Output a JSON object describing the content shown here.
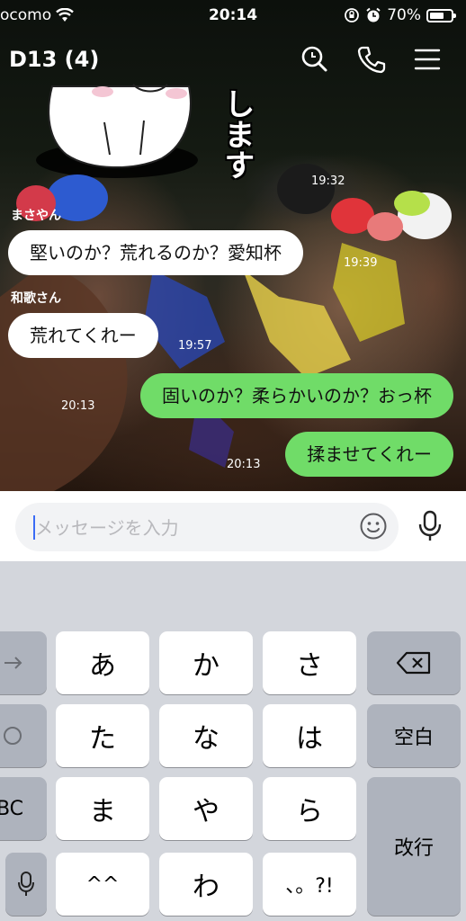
{
  "status_bar": {
    "carrier": "ocomo",
    "time": "20:14",
    "battery_percent": "70%",
    "battery_level": 0.7,
    "icons": [
      "wifi-icon",
      "orientation-lock-icon",
      "alarm-icon"
    ]
  },
  "header": {
    "title": "D13 (4)",
    "icons": [
      "search-icon",
      "phone-icon",
      "menu-icon"
    ]
  },
  "background": {
    "sticker_text": "します",
    "sticker_timestamp": "19:32"
  },
  "messages": [
    {
      "sender": "まさやん",
      "text": "堅いのか？荒れるのか？愛知杯",
      "time": "19:39",
      "direction": "incoming"
    },
    {
      "sender": "和歌さん",
      "text": "荒れてくれー",
      "time": "19:57",
      "direction": "incoming"
    },
    {
      "sender": "",
      "text": "固いのか？柔らかいのか？おっ杯",
      "time": "20:13",
      "direction": "outgoing"
    },
    {
      "sender": "",
      "text": "揉ませてくれー",
      "time": "20:13",
      "direction": "outgoing"
    }
  ],
  "input": {
    "placeholder": "メッセージを入力",
    "value": "",
    "icons": [
      "emoji-icon",
      "microphone-icon"
    ]
  },
  "keyboard": {
    "row1": [
      "あ",
      "か",
      "さ"
    ],
    "row2": [
      "た",
      "な",
      "は"
    ],
    "row3": [
      "ま",
      "や",
      "ら"
    ],
    "row4": [
      "^^",
      "わ",
      "、。?!"
    ],
    "space_label": "空白",
    "return_label": "改行",
    "abc_label": "BC",
    "icons": [
      "arrow-right-icon",
      "undo-icon",
      "microphone-icon",
      "backspace-icon"
    ]
  },
  "colors": {
    "outgoing_bubble": "#70dc68",
    "incoming_bubble": "#ffffff",
    "caret": "#3b6cf5"
  }
}
